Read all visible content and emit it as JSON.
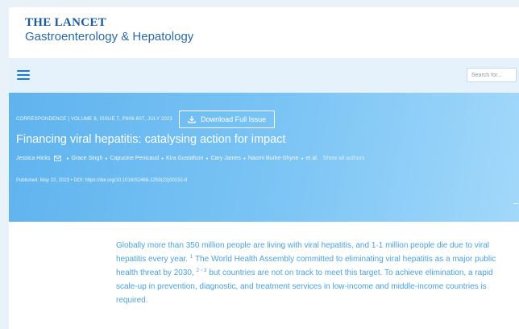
{
  "header": {
    "brand_top": "THE LANCET",
    "brand_sub": "Gastroenterology & Hepatology"
  },
  "nav": {
    "menu_icon": "hamburger-menu-icon",
    "search_placeholder": "Search for..."
  },
  "article": {
    "meta": "CORRESPONDENCE | VOLUME 8, ISSUE 7, P606-607, JULY 2023",
    "download_label": "Download Full Issue",
    "title": "Financing viral hepatitis: catalysing action for impact",
    "authors": [
      "Jessica Hicks",
      "Grace Singh",
      "Capucine Penicaud",
      "Kira Gustafson",
      "Cary James",
      "Naomi Burke-Shyne",
      "et al."
    ],
    "show_all_label": "Show all authors",
    "published": "Published: May 22, 2023 • DOI: https://doi.org/10.1016/S2468-1253(23)00152-8"
  },
  "body": {
    "p1_a": "Globally more than 350 million people are living with viral hepatitis, and 1·1 million people die due to viral hepatitis every year.",
    "ref1": "1",
    "p1_b": " The World Health Assembly committed to eliminating viral hepatitis as a major public health threat by 2030,",
    "ref2": "2 - 3",
    "p1_c": " but countries are not on track to meet this target. To achieve elimination, a rapid scale-up in prevention, diagnostic, and treatment services in low-income and middle-income countries is required."
  },
  "colors": {
    "brand": "#1a5a9a",
    "accent": "#1a7bd0",
    "hero_start": "#5fb3ee",
    "hero_end": "#a2d8fa",
    "body_text": "#4aa2e4"
  }
}
